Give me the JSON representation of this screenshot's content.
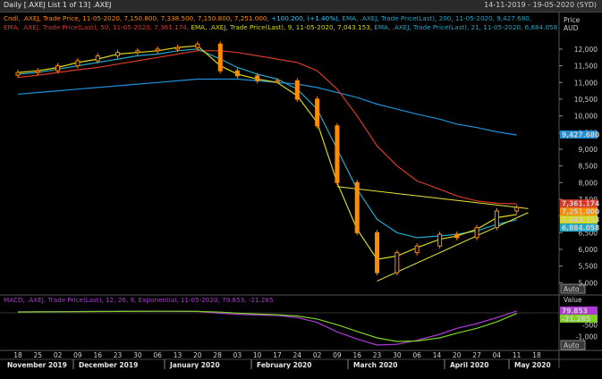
{
  "header": {
    "title": "Daily [.AXEJ List 1 of 13] .AXEJ",
    "date_range": "14-11-2019 - 19-05-2020 (SYD)"
  },
  "legend_price": {
    "line1_a": "Cndl, .AXEJ, Trade Price, 11-05-2020, 7,150.800, 7,338.500, 7,150.800, 7,251.000, ",
    "line1_b": "+100.200, (+1.40%),",
    "line1_c": " EMA, .AXEJ, Trade Price(Last), 200, 11-05-2020, 9,427.680,",
    "line2_a": "EMA, .AXEJ, Trade Price(Last), 50, 11-05-2020, 7,361.174,",
    "line2_b": " EMA, .AXEJ, Trade Price(Last), 9, 11-05-2020, 7,043.153,",
    "line2_c": " EMA, .AXEJ, Trade Price(Last), 21, 11-05-2020, 6,884.058"
  },
  "legend_macd": "MACD, .AXEJ, Trade Price(Last), 12, 26, 9, Exponential, 11-05-2020, 79.853, -21.285",
  "price_axis": {
    "title_line1": "Price",
    "title_line2": "AUD",
    "auto": "Auto",
    "ticks": [
      "12,000",
      "11,500",
      "11,000",
      "10,500",
      "10,000",
      "9,500",
      "9,000",
      "8,500",
      "8,000",
      "7,500",
      "7,000",
      "6,500",
      "6,000",
      "5,500",
      "5,000"
    ],
    "ticks_values": [
      12000,
      11500,
      11000,
      10500,
      10000,
      9500,
      9000,
      8500,
      8000,
      7500,
      7000,
      6500,
      6000,
      5500,
      5000
    ]
  },
  "price_labels": [
    {
      "text": "9,427.680",
      "color": "#1e8fd6",
      "value": 9427.68
    },
    {
      "text": "7,361.174",
      "color": "#d83a2a",
      "value": 7361.174
    },
    {
      "text": "7,251.000",
      "color": "#ff8c00",
      "value": 7251.0
    },
    {
      "text": "7,043.153",
      "color": "#d8d816",
      "value": 7043.153
    },
    {
      "text": "6,884.058",
      "color": "#1fa9c9",
      "value": 6884.058
    }
  ],
  "macd_axis": {
    "title": "Value",
    "auto": "Auto",
    "ticks": [
      "-500",
      "-1,000"
    ],
    "ticks_values": [
      -500,
      -1000
    ],
    "labels": [
      {
        "text": "79.853",
        "color": "#b03ad8",
        "value": 79.853
      },
      {
        "text": "-21.285",
        "color": "#7ed321",
        "value": -21.285
      }
    ]
  },
  "x_axis": {
    "day_ticks": [
      "18",
      "25",
      "02",
      "09",
      "16",
      "23",
      "30",
      "06",
      "13",
      "20",
      "28",
      "03",
      "10",
      "17",
      "24",
      "02",
      "09",
      "16",
      "23",
      "30",
      "06",
      "14",
      "20",
      "27",
      "04",
      "11",
      "18"
    ],
    "months": [
      "November 2019",
      "December 2019",
      "January 2020",
      "February 2020",
      "March 2020",
      "April 2020",
      "May 2020"
    ]
  },
  "chart_data": {
    "type": "line",
    "title": "",
    "ylabel": "Price AUD",
    "ylim": [
      4900,
      12400
    ],
    "x": [
      "2019-11-18",
      "2019-11-25",
      "2019-12-02",
      "2019-12-09",
      "2019-12-16",
      "2019-12-23",
      "2019-12-30",
      "2020-01-06",
      "2020-01-13",
      "2020-01-20",
      "2020-01-28",
      "2020-02-03",
      "2020-02-10",
      "2020-02-17",
      "2020-02-24",
      "2020-03-02",
      "2020-03-09",
      "2020-03-16",
      "2020-03-23",
      "2020-03-30",
      "2020-04-06",
      "2020-04-14",
      "2020-04-20",
      "2020-04-27",
      "2020-05-04",
      "2020-05-11"
    ],
    "series": [
      {
        "name": "Cndl Close",
        "color": "#ff8c00",
        "values": [
          11300,
          11350,
          11500,
          11650,
          11800,
          11900,
          11950,
          12000,
          12050,
          12150,
          11350,
          11200,
          11050,
          11050,
          10500,
          9700,
          8000,
          6500,
          5300,
          5900,
          6100,
          6450,
          6350,
          6650,
          7150,
          7251
        ]
      },
      {
        "name": "EMA 200",
        "color": "#1e8fd6",
        "values": [
          10650,
          10700,
          10750,
          10800,
          10850,
          10900,
          10950,
          11000,
          11050,
          11100,
          11100,
          11100,
          11050,
          11000,
          10950,
          10850,
          10700,
          10550,
          10350,
          10200,
          10050,
          9900,
          9750,
          9650,
          9520,
          9427.68
        ]
      },
      {
        "name": "EMA 50",
        "color": "#d83a2a",
        "values": [
          11150,
          11220,
          11300,
          11380,
          11450,
          11550,
          11650,
          11750,
          11850,
          11950,
          11950,
          11900,
          11800,
          11700,
          11600,
          11350,
          10800,
          10000,
          9100,
          8500,
          8050,
          7800,
          7600,
          7450,
          7380,
          7361.174
        ]
      },
      {
        "name": "EMA 21",
        "color": "#1fa9c9",
        "values": [
          11250,
          11300,
          11400,
          11500,
          11600,
          11700,
          11800,
          11850,
          11950,
          12000,
          11700,
          11450,
          11250,
          11100,
          10800,
          10200,
          9000,
          7800,
          6900,
          6500,
          6350,
          6400,
          6450,
          6550,
          6750,
          6884.058
        ]
      },
      {
        "name": "EMA 9",
        "color": "#d8d816",
        "values": [
          11300,
          11350,
          11450,
          11600,
          11700,
          11850,
          11900,
          11950,
          12050,
          12100,
          11500,
          11250,
          11100,
          11000,
          10600,
          9800,
          8000,
          6600,
          5700,
          5800,
          6050,
          6300,
          6400,
          6600,
          6950,
          7043.153
        ]
      }
    ],
    "trendlines": [
      {
        "color": "#e8e83a",
        "from": {
          "x": "2020-03-09",
          "y": 7880
        },
        "to": {
          "x": "2020-05-15",
          "y": 7220
        }
      },
      {
        "color": "#e8e83a",
        "from": {
          "x": "2020-03-23",
          "y": 5050
        },
        "to": {
          "x": "2020-05-15",
          "y": 7100
        }
      }
    ],
    "macd": {
      "ylim": [
        -1500,
        300
      ],
      "series": [
        {
          "name": "MACD",
          "color": "#b03ad8",
          "values": [
            40,
            45,
            50,
            55,
            60,
            65,
            70,
            70,
            65,
            60,
            -20,
            -60,
            -90,
            -110,
            -200,
            -400,
            -800,
            -1100,
            -1350,
            -1320,
            -1150,
            -900,
            -650,
            -450,
            -200,
            79.853
          ]
        },
        {
          "name": "Signal",
          "color": "#7ed321",
          "values": [
            35,
            40,
            45,
            50,
            55,
            60,
            65,
            68,
            66,
            62,
            30,
            -10,
            -50,
            -80,
            -130,
            -260,
            -500,
            -780,
            -1050,
            -1200,
            -1180,
            -1050,
            -850,
            -650,
            -380,
            -21.285
          ]
        }
      ]
    }
  }
}
